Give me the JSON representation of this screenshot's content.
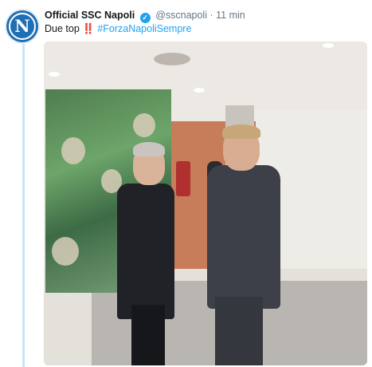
{
  "tweet": {
    "author_name": "Official SSC Napoli",
    "verified_icon": "check-badge-icon",
    "handle": "@sscnapoli",
    "separator": "·",
    "time": "11 min",
    "text": "Due top ‼️ ",
    "hashtag": "#ForzaNapoliSempre",
    "avatar_letter": "N"
  },
  "colors": {
    "accent": "#1da1f2",
    "thread_line": "#c9e6f5",
    "avatar_bg": "#1f6fb5"
  }
}
